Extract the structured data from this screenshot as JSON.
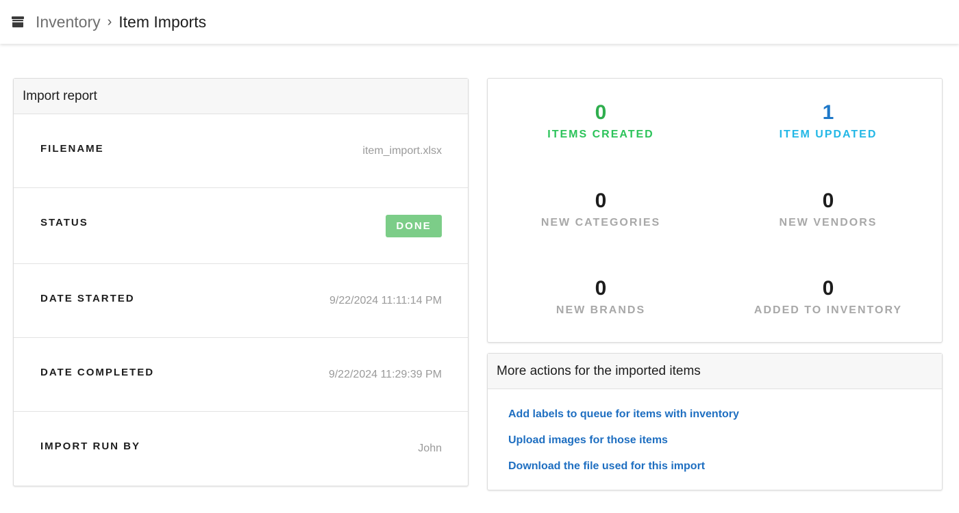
{
  "header": {
    "app_icon": "archive-box-icon",
    "breadcrumb_root": "Inventory",
    "breadcrumb_separator": "›",
    "breadcrumb_current": "Item Imports"
  },
  "report": {
    "title": "Import report",
    "rows": [
      {
        "label": "FILENAME",
        "value": "item_import.xlsx"
      },
      {
        "label": "STATUS",
        "value": "DONE"
      },
      {
        "label": "DATE STARTED",
        "value": "9/22/2024 11:11:14 PM"
      },
      {
        "label": "DATE COMPLETED",
        "value": "9/22/2024 11:29:39 PM"
      },
      {
        "label": "IMPORT RUN BY",
        "value": "John"
      }
    ],
    "status_color": "#7ccd88"
  },
  "stats": [
    {
      "value": "0",
      "label": "ITEMS CREATED",
      "num_color": "#2fae4e",
      "label_color": "#2cc35a"
    },
    {
      "value": "1",
      "label": "ITEM UPDATED",
      "num_color": "#1e78c8",
      "label_color": "#22b7e6"
    },
    {
      "value": "0",
      "label": "NEW CATEGORIES",
      "num_color": "#1d1d1d",
      "label_color": "#a8a8a8"
    },
    {
      "value": "0",
      "label": "NEW VENDORS",
      "num_color": "#1d1d1d",
      "label_color": "#a8a8a8"
    },
    {
      "value": "0",
      "label": "NEW BRANDS",
      "num_color": "#1d1d1d",
      "label_color": "#a8a8a8"
    },
    {
      "value": "0",
      "label": "ADDED TO INVENTORY",
      "num_color": "#1d1d1d",
      "label_color": "#a8a8a8"
    }
  ],
  "actions": {
    "title": "More actions for the imported items",
    "links": [
      "Add labels to queue for items with inventory",
      "Upload images for those items",
      "Download the file used for this import"
    ],
    "link_color": "#1f6fc1"
  }
}
